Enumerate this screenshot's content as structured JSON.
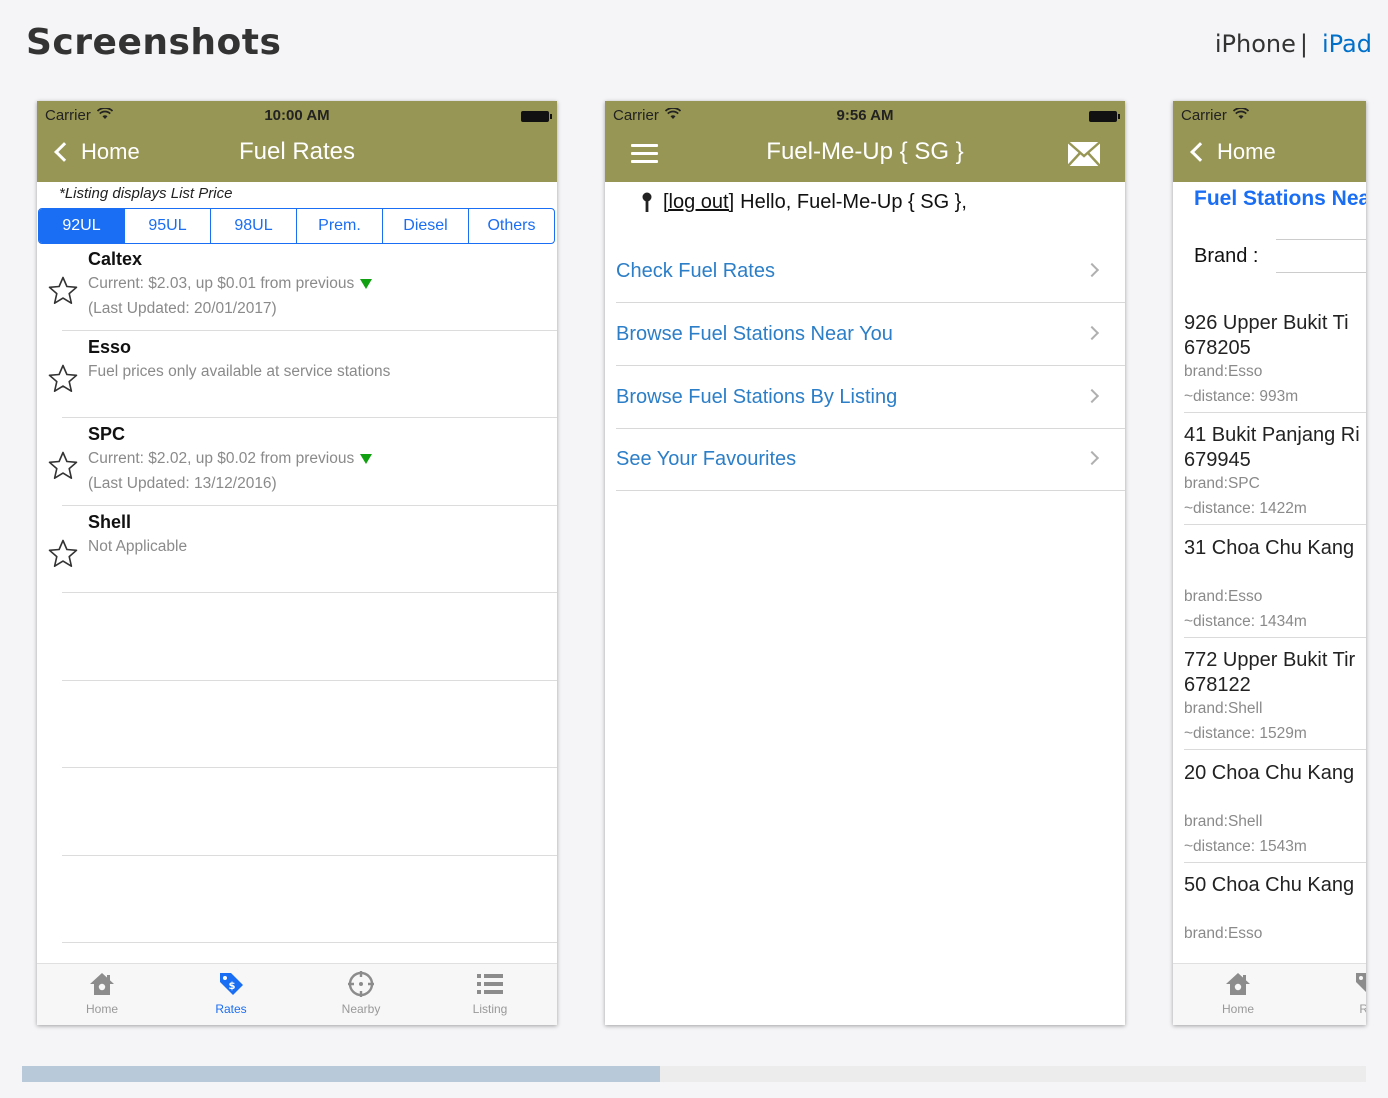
{
  "header": {
    "title": "Screenshots",
    "devices": [
      "iPhone",
      "iPad"
    ],
    "separator": "|",
    "active_device": "iPad"
  },
  "shot1": {
    "status": {
      "carrier": "Carrier",
      "time": "10:00 AM"
    },
    "nav": {
      "back": "Home",
      "title": "Fuel Rates"
    },
    "note": "*Listing displays List Price",
    "segments": [
      "92UL",
      "95UL",
      "98UL",
      "Prem.",
      "Diesel",
      "Others"
    ],
    "active_segment": "92UL",
    "rows": [
      {
        "name": "Caltex",
        "line1": "Current: $2.03, up $0.01 from previous",
        "line2": "(Last Updated: 20/01/2017)",
        "trend_icon": "down-triangle-icon"
      },
      {
        "name": "Esso",
        "line1": "Fuel prices only available at service stations",
        "line2": ""
      },
      {
        "name": "SPC",
        "line1": "Current: $2.02, up $0.02 from previous",
        "line2": "(Last Updated: 13/12/2016)",
        "trend_icon": "down-triangle-icon"
      },
      {
        "name": "Shell",
        "line1": "Not Applicable",
        "line2": ""
      }
    ],
    "tabs": [
      {
        "label": "Home",
        "icon": "home-icon"
      },
      {
        "label": "Rates",
        "icon": "price-tag-icon"
      },
      {
        "label": "Nearby",
        "icon": "crosshair-icon"
      },
      {
        "label": "Listing",
        "icon": "list-icon"
      }
    ],
    "active_tab": "Rates"
  },
  "shot2": {
    "status": {
      "carrier": "Carrier",
      "time": "9:56 AM"
    },
    "nav": {
      "title": "Fuel-Me-Up { SG }",
      "left_icon": "menu-icon",
      "right_icon": "mail-icon"
    },
    "hello": {
      "logout": "[log out]",
      "text": "Hello, Fuel-Me-Up { SG },"
    },
    "menu": [
      "Check Fuel Rates",
      "Browse Fuel Stations Near You",
      "Browse Fuel Stations By Listing",
      "See Your Favourites"
    ]
  },
  "shot3": {
    "status": {
      "carrier": "Carrier"
    },
    "nav": {
      "back": "Home"
    },
    "heading": "Fuel Stations Nea",
    "brand_label": "Brand :",
    "stations": [
      {
        "address": "926 Upper Bukit Ti\n678205",
        "brand": "brand:Esso",
        "distance": "~distance: 993m"
      },
      {
        "address": "41 Bukit Panjang Ri\n679945",
        "brand": "brand:SPC",
        "distance": "~distance: 1422m"
      },
      {
        "address": "31 Choa Chu Kang",
        "brand": "brand:Esso",
        "distance": "~distance: 1434m"
      },
      {
        "address": "772 Upper Bukit Tir\n678122",
        "brand": "brand:Shell",
        "distance": "~distance: 1529m"
      },
      {
        "address": "20 Choa Chu Kang",
        "brand": "brand:Shell",
        "distance": "~distance: 1543m"
      },
      {
        "address": "50 Choa Chu Kang",
        "brand": "brand:Esso",
        "distance": ""
      }
    ],
    "tabs": [
      {
        "label": "Home",
        "icon": "home-icon"
      },
      {
        "label": "Ra",
        "icon": "price-tag-icon"
      }
    ]
  },
  "colors": {
    "navbar": "#979654",
    "accent_blue": "#1a6ef3",
    "link_blue": "#2b7ec7",
    "trend_green": "#11a011"
  }
}
